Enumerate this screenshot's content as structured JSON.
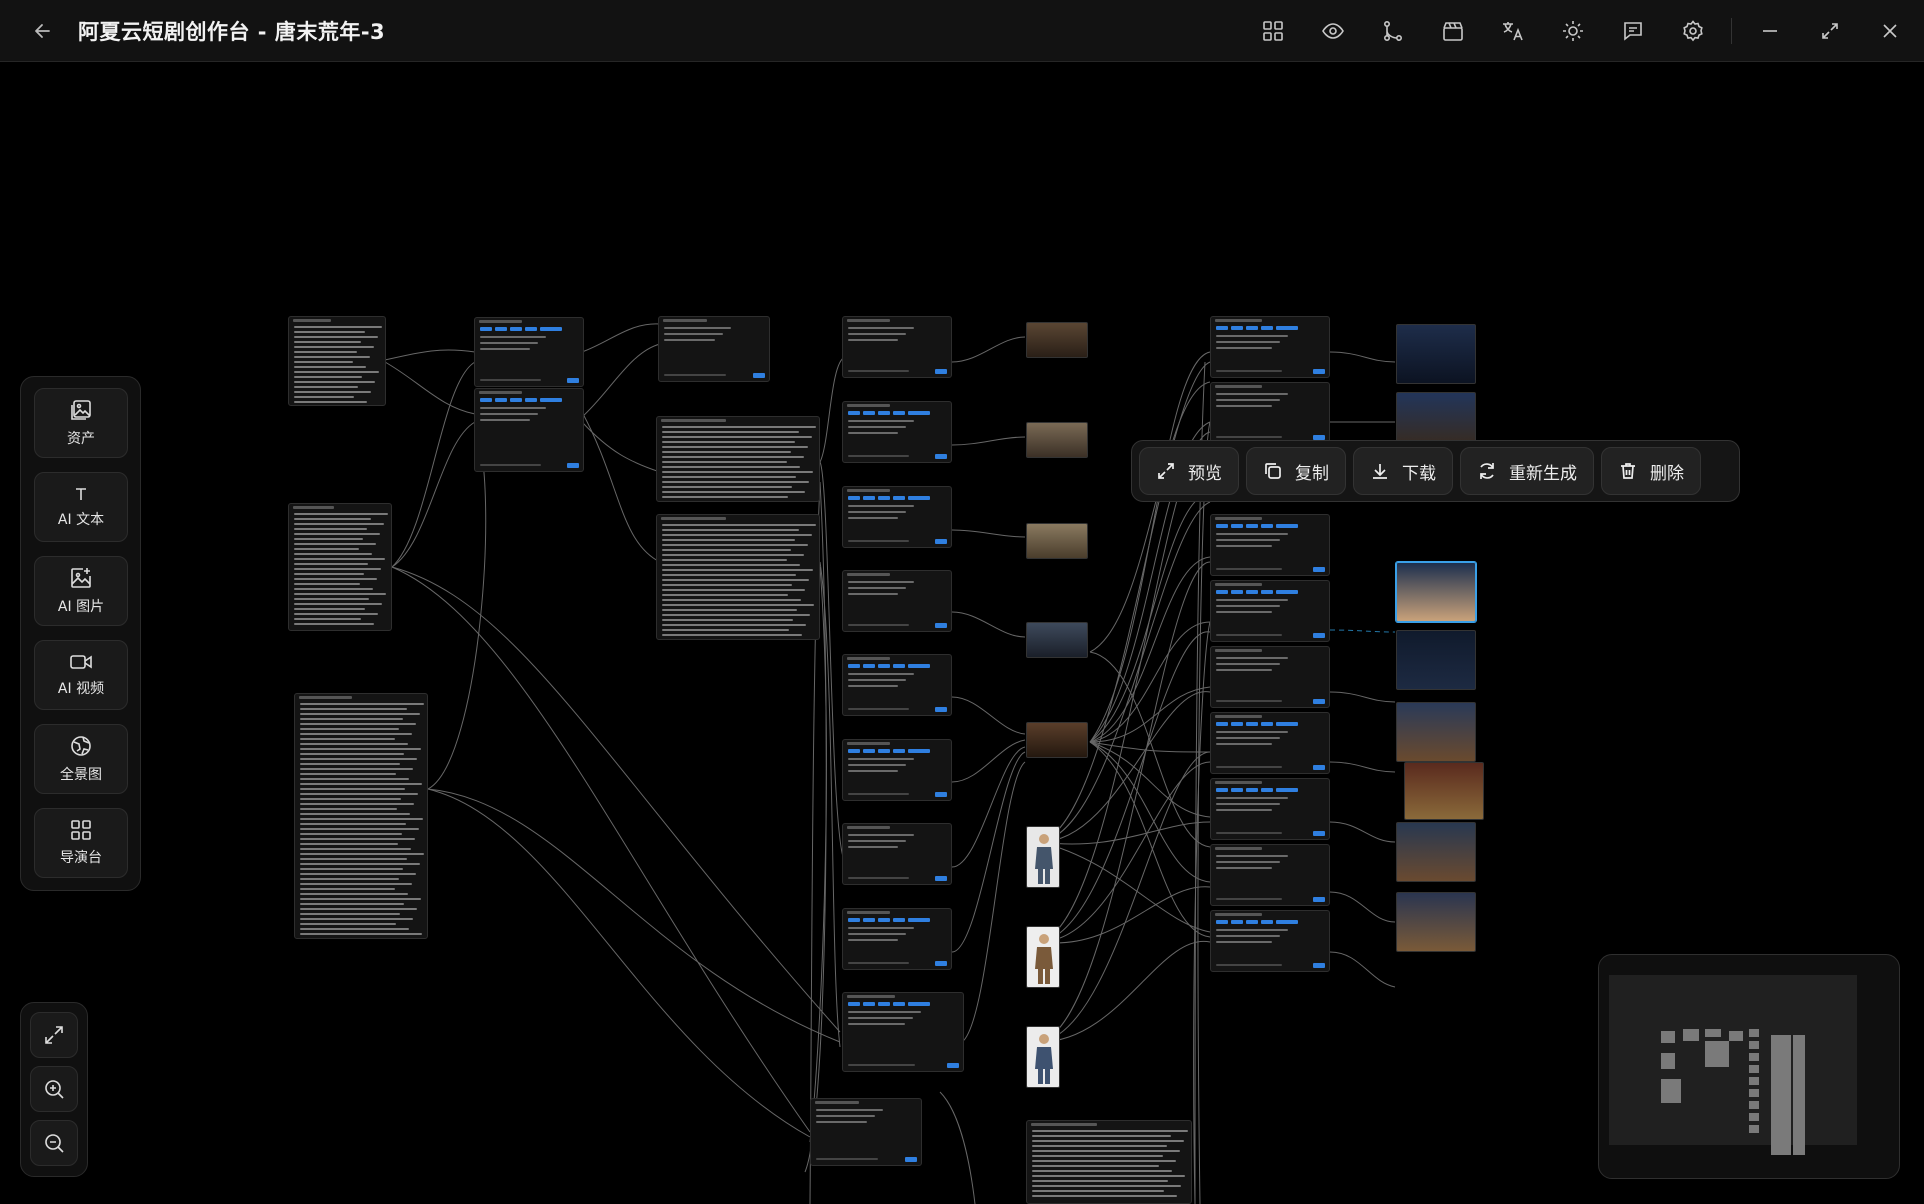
{
  "window": {
    "title": "阿夏云短剧创作台 - 唐末荒年-3",
    "toolbar_icons": [
      "grid-icon",
      "eye-icon",
      "branch-icon",
      "clapper-icon",
      "translate-icon",
      "sun-icon",
      "chat-icon",
      "gear-icon"
    ],
    "window_controls": [
      "minimize-icon",
      "maximize-icon",
      "close-icon"
    ]
  },
  "dock": {
    "items": [
      {
        "label": "资产",
        "icon": "asset-image-icon"
      },
      {
        "label": "AI 文本",
        "icon": "text-icon"
      },
      {
        "label": "AI 图片",
        "icon": "image-plus-icon"
      },
      {
        "label": "AI 视频",
        "icon": "video-icon"
      },
      {
        "label": "全景图",
        "icon": "panorama-icon"
      },
      {
        "label": "导演台",
        "icon": "dashboard-grid-icon"
      }
    ]
  },
  "zoom": {
    "buttons": [
      "fit-view-icon",
      "zoom-in-icon",
      "zoom-out-icon"
    ]
  },
  "context_menu": {
    "items": [
      {
        "label": "预览",
        "icon": "expand-icon"
      },
      {
        "label": "复制",
        "icon": "copy-icon"
      },
      {
        "label": "下载",
        "icon": "download-icon"
      },
      {
        "label": "重新生成",
        "icon": "refresh-icon"
      },
      {
        "label": "删除",
        "icon": "trash-icon"
      }
    ]
  },
  "colors": {
    "accent": "#2f7fe0",
    "background": "#000000",
    "panel": "#141414"
  }
}
